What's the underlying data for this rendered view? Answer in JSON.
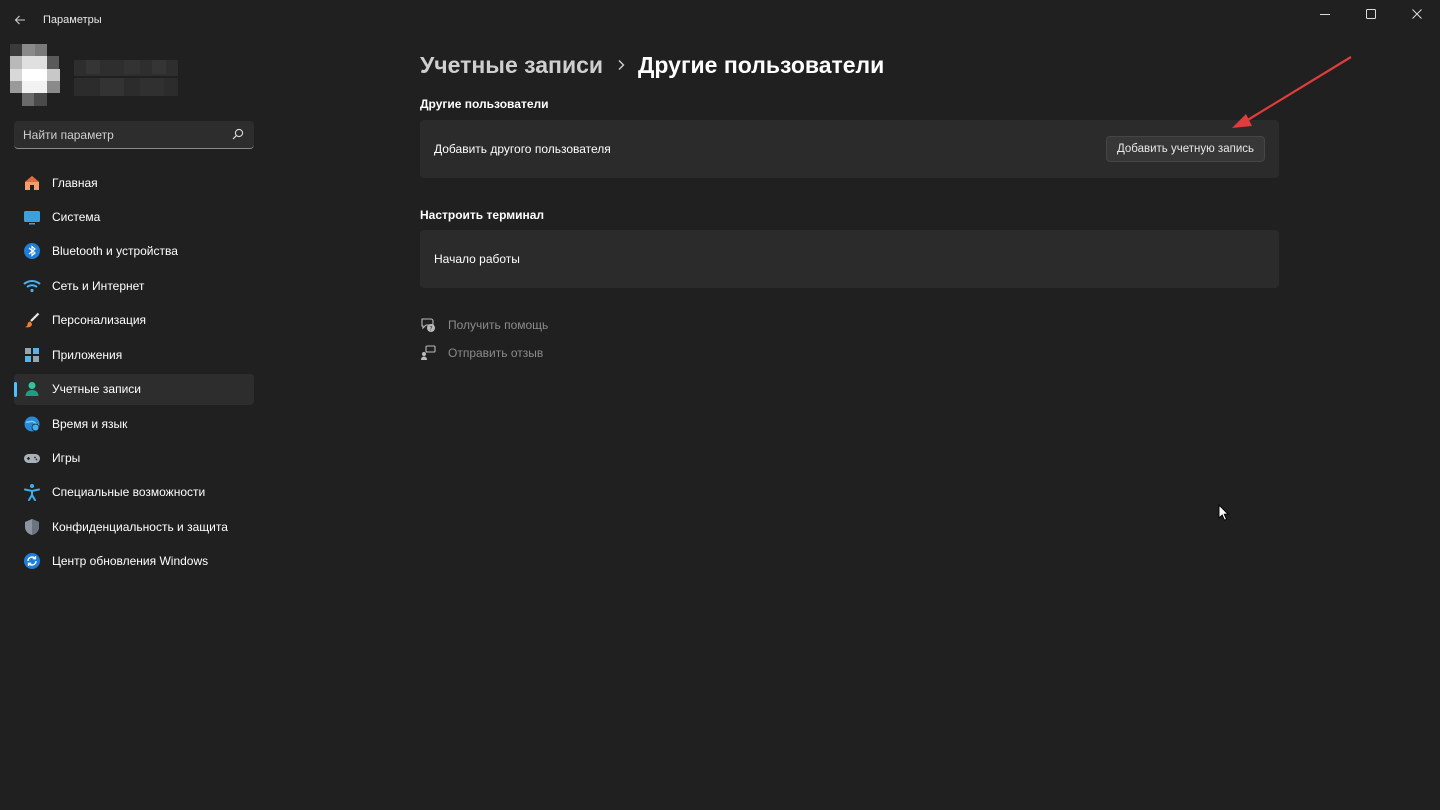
{
  "window": {
    "title": "Параметры",
    "accent_color": "#4cc2ff",
    "background_color": "#202020"
  },
  "search": {
    "placeholder": "Найти параметр"
  },
  "sidebar": {
    "items": [
      {
        "label": "Главная",
        "icon": "home-icon"
      },
      {
        "label": "Система",
        "icon": "system-icon"
      },
      {
        "label": "Bluetooth и устройства",
        "icon": "bluetooth-icon"
      },
      {
        "label": "Сеть и Интернет",
        "icon": "wifi-icon"
      },
      {
        "label": "Персонализация",
        "icon": "brush-icon"
      },
      {
        "label": "Приложения",
        "icon": "apps-icon"
      },
      {
        "label": "Учетные записи",
        "icon": "accounts-icon",
        "active": true
      },
      {
        "label": "Время и язык",
        "icon": "globe-clock-icon"
      },
      {
        "label": "Игры",
        "icon": "gamepad-icon"
      },
      {
        "label": "Специальные возможности",
        "icon": "accessibility-icon"
      },
      {
        "label": "Конфиденциальность и защита",
        "icon": "shield-icon"
      },
      {
        "label": "Центр обновления Windows",
        "icon": "update-icon"
      }
    ]
  },
  "breadcrumb": {
    "parent": "Учетные записи",
    "current": "Другие пользователи"
  },
  "sections": {
    "other_users": {
      "title": "Другие пользователи",
      "row_label": "Добавить другого пользователя",
      "button_label": "Добавить учетную запись"
    },
    "kiosk": {
      "title": "Настроить терминал",
      "row_label": "Начало работы"
    }
  },
  "links": {
    "help": "Получить помощь",
    "feedback": "Отправить отзыв"
  },
  "annotation": {
    "arrow_color": "#e03c3c"
  }
}
